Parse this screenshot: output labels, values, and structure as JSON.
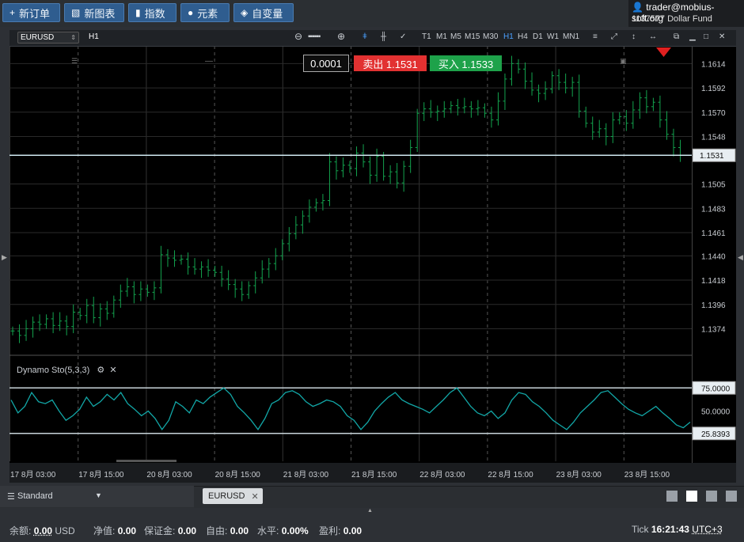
{
  "toolbar": {
    "new_order": "新订单",
    "new_chart": "新图表",
    "indicators": "指数",
    "elements": "元素",
    "variables": "自变量"
  },
  "account": {
    "email": "trader@mobius-soft.org",
    "id_fund": "1137577  Dollar Fund"
  },
  "chart_toolbar": {
    "symbol": "EURUSD",
    "timeframe": "H1",
    "timeframes": [
      "T1",
      "M1",
      "M5",
      "M15",
      "M30",
      "H1",
      "H4",
      "D1",
      "W1",
      "MN1"
    ],
    "active_timeframe": "H1"
  },
  "trade": {
    "spread_value": "0.0001",
    "sell_label": "卖出 1.1531",
    "buy_label": "买入 1.1533"
  },
  "indicator": {
    "name": "Dynamo Sto(5,3,3)",
    "level_high": "75.0000",
    "level_mid": "50.0000",
    "level_current": "25.8393"
  },
  "chart_data": [
    {
      "type": "candlestick",
      "symbol": "EURUSD",
      "timeframe": "H1",
      "y_ticks": [
        "1.1614",
        "1.1592",
        "1.1570",
        "1.1548",
        "1.1505",
        "1.1483",
        "1.1461",
        "1.1440",
        "1.1418",
        "1.1396",
        "1.1374"
      ],
      "current_price": "1.1531",
      "ylim": [
        1.135,
        1.163
      ],
      "x_ticks": [
        "17 8月 03:00",
        "17 8月 15:00",
        "20 8月 03:00",
        "20 8月 15:00",
        "21 8月 03:00",
        "21 8月 15:00",
        "22 8月 03:00",
        "22 8月 15:00",
        "23 8月 03:00",
        "23 8月 15:00"
      ],
      "closes": [
        1.1372,
        1.1368,
        1.1374,
        1.138,
        1.1378,
        1.1383,
        1.1377,
        1.1381,
        1.1376,
        1.1389,
        1.1386,
        1.1395,
        1.1384,
        1.1392,
        1.1388,
        1.14,
        1.1408,
        1.1412,
        1.1405,
        1.141,
        1.1407,
        1.1411,
        1.1441,
        1.1438,
        1.1436,
        1.1437,
        1.143,
        1.1428,
        1.143,
        1.1427,
        1.1425,
        1.1419,
        1.1414,
        1.141,
        1.1405,
        1.1413,
        1.142,
        1.1428,
        1.1433,
        1.144,
        1.1451,
        1.146,
        1.1468,
        1.1476,
        1.1484,
        1.1488,
        1.149,
        1.1525,
        1.1517,
        1.1522,
        1.1519,
        1.1533,
        1.1525,
        1.1513,
        1.153,
        1.1512,
        1.1516,
        1.1506,
        1.1521,
        1.1538,
        1.1569,
        1.1573,
        1.157,
        1.1571,
        1.1573,
        1.1576,
        1.1574,
        1.1575,
        1.1573,
        1.1574,
        1.1569,
        1.1563,
        1.158,
        1.16,
        1.1614,
        1.1609,
        1.1598,
        1.159,
        1.1587,
        1.1591,
        1.1603,
        1.1597,
        1.1592,
        1.1597,
        1.1571,
        1.156,
        1.1552,
        1.1555,
        1.1548,
        1.1563,
        1.1566,
        1.156,
        1.1572,
        1.1583,
        1.1575,
        1.1579,
        1.1563,
        1.155,
        1.1538,
        1.1531
      ],
      "stochastic": {
        "name": "Dynamo Sto(5,3,3)",
        "levels": [
          75,
          50,
          25.8393
        ],
        "ylim": [
          0,
          100
        ],
        "values": [
          62,
          48,
          55,
          70,
          60,
          58,
          62,
          50,
          40,
          45,
          52,
          65,
          55,
          60,
          68,
          62,
          70,
          58,
          52,
          45,
          50,
          42,
          30,
          40,
          60,
          55,
          48,
          62,
          58,
          65,
          70,
          75,
          68,
          55,
          48,
          40,
          30,
          42,
          58,
          62,
          70,
          72,
          68,
          60,
          55,
          58,
          62,
          60,
          55,
          45,
          40,
          30,
          38,
          50,
          58,
          65,
          70,
          62,
          58,
          55,
          52,
          48,
          55,
          62,
          70,
          75,
          65,
          55,
          48,
          45,
          50,
          42,
          48,
          62,
          70,
          68,
          60,
          55,
          48,
          40,
          35,
          30,
          38,
          48,
          55,
          62,
          70,
          72,
          65,
          58,
          52,
          48,
          45,
          50,
          55,
          48,
          42,
          35,
          32,
          38
        ]
      }
    }
  ],
  "tabs": {
    "layout_select": "Standard",
    "chart_tab": "EURUSD"
  },
  "status": {
    "balance_label": "余额:",
    "balance_value": "0.00",
    "balance_ccy": "USD",
    "equity_label": "净值:",
    "equity_value": "0.00",
    "margin_label": "保证金:",
    "margin_value": "0.00",
    "free_label": "自由:",
    "free_value": "0.00",
    "level_label": "水平:",
    "level_value": "0.00%",
    "pl_label": "盈利:",
    "pl_value": "0.00",
    "tick_label": "Tick",
    "time": "16:21:43",
    "tz": "UTC+3"
  },
  "colors": {
    "candle": "#13a34e",
    "sto_line": "#12a7a7",
    "sell": "#e23131",
    "buy": "#1ea24a",
    "toolbar_btn": "#2f5d8f"
  }
}
